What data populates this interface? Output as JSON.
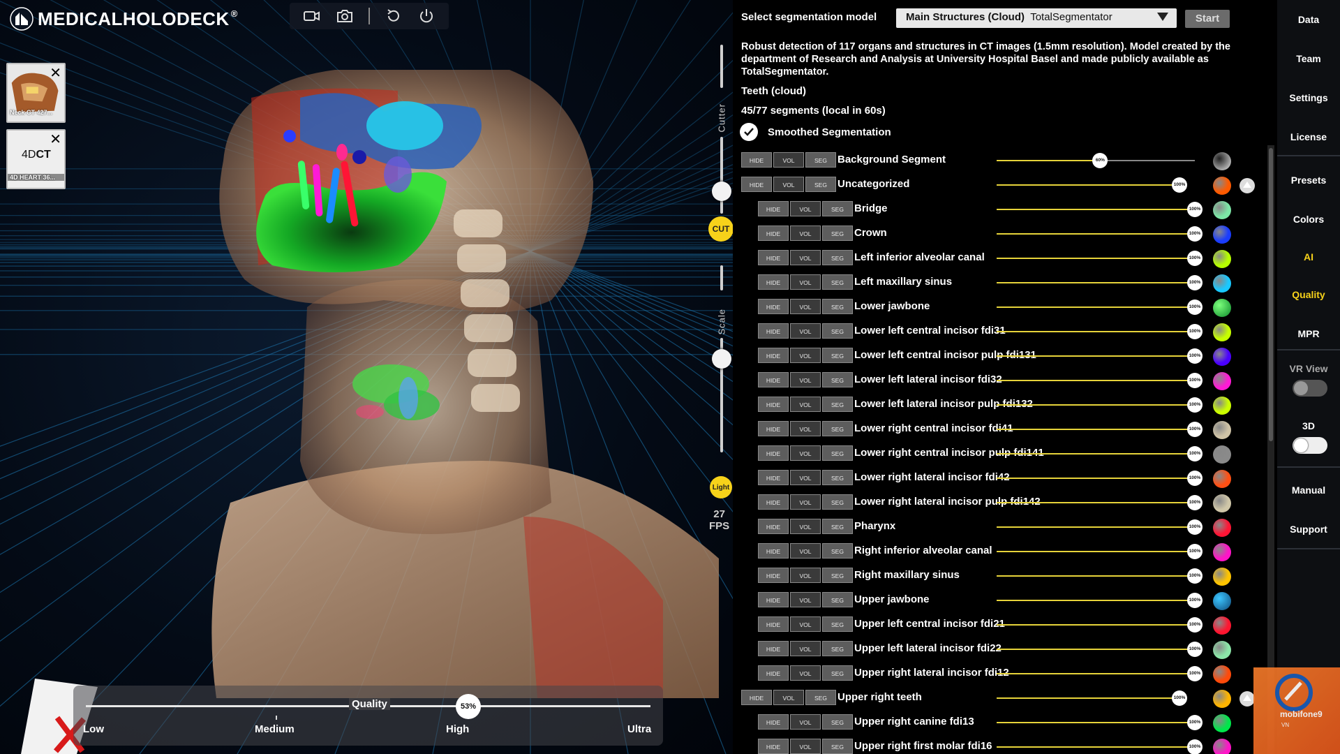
{
  "app": {
    "brand": "MEDICALHOLODECK",
    "registered": "®"
  },
  "datasets": [
    {
      "caption": "Neck CT 427..."
    },
    {
      "brand_prefix": "4D",
      "brand_suffix": "CT",
      "caption": "4D HEART 36..."
    }
  ],
  "viewport": {
    "cutter_label": "Cutter",
    "cut_button": "CUT",
    "scale_label": "Scale",
    "light_button": "Light",
    "fps_value": "27",
    "fps_unit": "FPS"
  },
  "quality": {
    "title": "Quality",
    "value_label": "53%",
    "value": 0.53,
    "ticks": [
      "Low",
      "Medium",
      "High",
      "Ultra"
    ]
  },
  "segmentation": {
    "select_label": "Select segmentation model",
    "model_name": "Main Structures (Cloud)",
    "model_sub": "TotalSegmentator",
    "start_label": "Start",
    "description": "Robust detection of 117 organs and structures in CT images (1.5mm resolution). Model created by the department of Research and Analysis at University Hospital Basel and made publicly available as TotalSegmentator.",
    "model_title": "Teeth (cloud)",
    "count": "45/77 segments (local in 60s)",
    "smoothed_label": "Smoothed Segmentation",
    "btn_hide": "HIDE",
    "btn_vol": "VOL",
    "btn_seg": "SEG",
    "rows": [
      {
        "name": "Background Segment",
        "level": 0,
        "pct": "60%",
        "pct_value": 0.6,
        "color": "#e8e8e8",
        "color2": "#222222",
        "group": true,
        "up": false
      },
      {
        "name": "Uncategorized",
        "level": 0,
        "pct": "100%",
        "pct_value": 1,
        "color": "#ff5a00",
        "group": true,
        "up": true
      },
      {
        "name": "Bridge",
        "level": 1,
        "pct": "100%",
        "pct_value": 1,
        "color": "#7de6a6"
      },
      {
        "name": "Crown",
        "level": 1,
        "pct": "100%",
        "pct_value": 1,
        "color": "#1a3cff"
      },
      {
        "name": "Left inferior alveolar canal",
        "level": 1,
        "pct": "100%",
        "pct_value": 1,
        "color": "#b6ff00"
      },
      {
        "name": "Left maxillary sinus",
        "level": 1,
        "pct": "100%",
        "pct_value": 1,
        "color": "#19c8ff"
      },
      {
        "name": "Lower jawbone",
        "level": 1,
        "pct": "100%",
        "pct_value": 1,
        "color": "#0c8a2a",
        "color2": "#7cff7c"
      },
      {
        "name": "Lower left central incisor fdi31",
        "level": 1,
        "pct": "100%",
        "pct_value": 1,
        "color": "#c6ff00"
      },
      {
        "name": "Lower left central incisor pulp fdi131",
        "level": 1,
        "pct": "100%",
        "pct_value": 1,
        "color": "#4a00ff"
      },
      {
        "name": "Lower left lateral incisor fdi32",
        "level": 1,
        "pct": "100%",
        "pct_value": 1,
        "color": "#ff1ad6"
      },
      {
        "name": "Lower left lateral incisor pulp fdi132",
        "level": 1,
        "pct": "100%",
        "pct_value": 1,
        "color": "#ccff00"
      },
      {
        "name": "Lower right central incisor fdi41",
        "level": 1,
        "pct": "100%",
        "pct_value": 1,
        "color": "#cfc3a6"
      },
      {
        "name": "Lower right central incisor pulp fdi141",
        "level": 1,
        "pct": "100%",
        "pct_value": 1,
        "color": "#8a8a8a"
      },
      {
        "name": "Lower right lateral incisor fdi42",
        "level": 1,
        "pct": "100%",
        "pct_value": 1,
        "color": "#ff5014"
      },
      {
        "name": "Lower right lateral incisor pulp fdi142",
        "level": 1,
        "pct": "100%",
        "pct_value": 1,
        "color": "#cfc6a8"
      },
      {
        "name": "Pharynx",
        "level": 1,
        "pct": "100%",
        "pct_value": 1,
        "color": "#ff1535"
      },
      {
        "name": "Right inferior alveolar canal",
        "level": 1,
        "pct": "100%",
        "pct_value": 1,
        "color": "#ff14c8"
      },
      {
        "name": "Right maxillary sinus",
        "level": 1,
        "pct": "100%",
        "pct_value": 1,
        "color": "#ffc400"
      },
      {
        "name": "Upper jawbone",
        "level": 1,
        "pct": "100%",
        "pct_value": 1,
        "color": "#0e4a7a",
        "color2": "#3cc6ff"
      },
      {
        "name": "Upper left central incisor fdi21",
        "level": 1,
        "pct": "100%",
        "pct_value": 1,
        "color": "#ff1530"
      },
      {
        "name": "Upper left lateral incisor fdi22",
        "level": 1,
        "pct": "100%",
        "pct_value": 1,
        "color": "#8ce6a8"
      },
      {
        "name": "Upper right lateral incisor fdi12",
        "level": 1,
        "pct": "100%",
        "pct_value": 1,
        "color": "#ff4a0a"
      },
      {
        "name": "Upper right teeth",
        "level": 0,
        "pct": "100%",
        "pct_value": 1,
        "color": "#ffb400",
        "group": true,
        "up": true
      },
      {
        "name": "Upper right canine fdi13",
        "level": 1,
        "pct": "100%",
        "pct_value": 1,
        "color": "#00e64a"
      },
      {
        "name": "Upper right first molar fdi16",
        "level": 1,
        "pct": "100%",
        "pct_value": 1,
        "color": "#ff14c8"
      }
    ]
  },
  "menu": {
    "items": [
      "Data",
      "Team",
      "Settings",
      "License",
      "Presets",
      "Colors",
      "AI",
      "Quality",
      "MPR"
    ],
    "active": [
      "AI",
      "Quality"
    ],
    "vr_label": "VR View",
    "vr_on": false,
    "label_3d": "3D",
    "on_3d": true,
    "manual": "Manual",
    "support": "Support"
  },
  "watermark": {
    "text": "mobifone9",
    "sub": "VN"
  }
}
